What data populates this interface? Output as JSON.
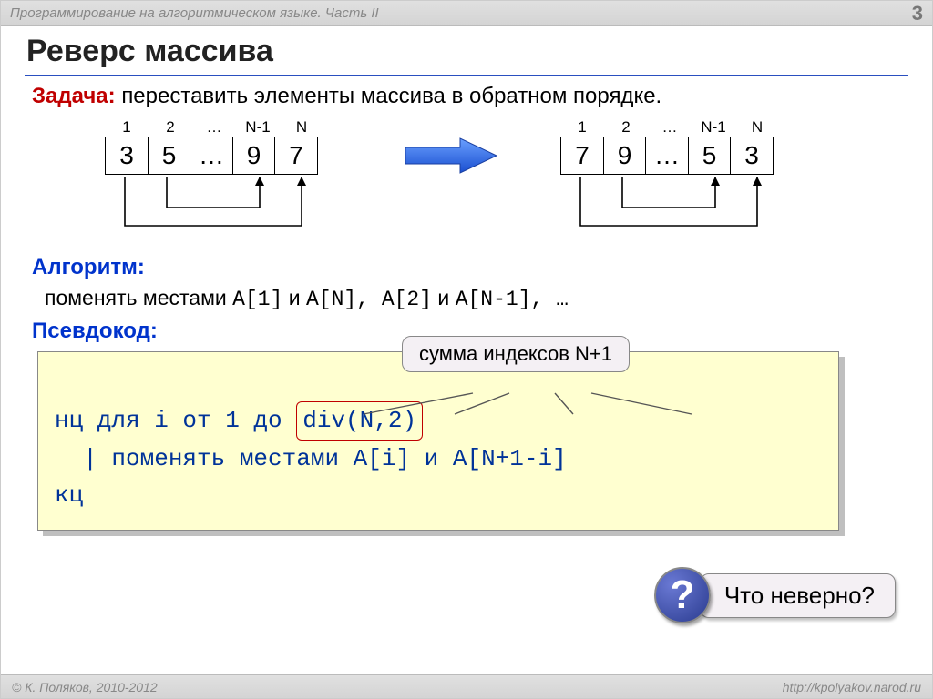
{
  "header": {
    "title": "Программирование на алгоритмическом языке. Часть II",
    "page": "3"
  },
  "slide_title": "Реверс массива",
  "task": {
    "label": "Задача:",
    "text": "переставить элементы массива в обратном порядке."
  },
  "arrays": {
    "indices": [
      "1",
      "2",
      "…",
      "N-1",
      "N"
    ],
    "left": [
      "3",
      "5",
      "…",
      "9",
      "7"
    ],
    "right": [
      "7",
      "9",
      "…",
      "5",
      "3"
    ]
  },
  "tooltip": "сумма индексов N+1",
  "algo": {
    "label": "Алгоритм:",
    "line_prefix": "поменять местами ",
    "pair1a": "A[1]",
    "and1": " и ",
    "pair1b": "A[N]",
    "comma1": ", ",
    "pair2a": "A[2]",
    "and2": " и ",
    "pair2b": "A[N-1]",
    "tail": ", …"
  },
  "pseudo": {
    "label": "Псевдокод:",
    "l1a": "нц для i от 1 до ",
    "l1b": "div(N,2)",
    "l2": "  | поменять местами A[i] и A[N+1-i]",
    "l3": "кц"
  },
  "question": {
    "mark": "?",
    "text": "Что неверно?"
  },
  "footer": {
    "copyright": "© К. Поляков, 2010-2012",
    "url": "http://kpolyakov.narod.ru"
  }
}
